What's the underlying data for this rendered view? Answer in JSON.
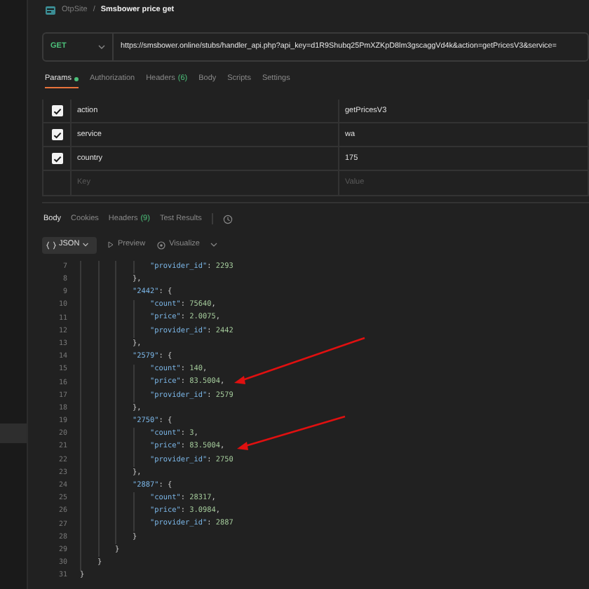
{
  "breadcrumb": {
    "workspace": "OtpSite",
    "separator": "/",
    "request": "Smsbower price get"
  },
  "request": {
    "method": "GET",
    "url": "https://smsbower.online/stubs/handler_api.php?api_key=d1R9Shubq25PmXZKpD8lm3gscaggVd4k&action=getPricesV3&service="
  },
  "request_tabs": [
    {
      "label": "Params",
      "dot": true,
      "selected": true
    },
    {
      "label": "Authorization",
      "dot": false,
      "selected": false
    },
    {
      "label": "Headers",
      "count": "(6)",
      "dot": false,
      "selected": false
    },
    {
      "label": "Body",
      "dot": false,
      "selected": false
    },
    {
      "label": "Scripts",
      "dot": false,
      "selected": false
    },
    {
      "label": "Settings",
      "dot": false,
      "selected": false
    }
  ],
  "params": [
    {
      "key": "action",
      "value": "getPricesV3",
      "checked": true
    },
    {
      "key": "service",
      "value": "wa",
      "checked": true
    },
    {
      "key": "country",
      "value": "175",
      "checked": true
    }
  ],
  "new_param": {
    "key_placeholder": "Key",
    "value_placeholder": "Value"
  },
  "response_tabs": [
    {
      "label": "Body",
      "selected": true
    },
    {
      "label": "Cookies",
      "selected": false
    },
    {
      "label": "Headers",
      "count": "(9)",
      "selected": false
    },
    {
      "label": "Test Results",
      "selected": false
    }
  ],
  "response_toolbar": {
    "format": "JSON",
    "preview": "Preview",
    "visualize": "Visualize"
  },
  "code_lines": [
    {
      "number": "7",
      "text": "        \"provider_id\": 2293"
    },
    {
      "number": "8",
      "text": "      },"
    },
    {
      "number": "9",
      "text": "      \"2442\": {"
    },
    {
      "number": "10",
      "text": "        \"count\": 75640,"
    },
    {
      "number": "11",
      "text": "        \"price\": 2.0075,"
    },
    {
      "number": "12",
      "text": "        \"provider_id\": 2442"
    },
    {
      "number": "13",
      "text": "      },"
    },
    {
      "number": "14",
      "text": "      \"2579\": {"
    },
    {
      "number": "15",
      "text": "        \"count\": 140,"
    },
    {
      "number": "16",
      "text": "        \"price\": 83.5004,"
    },
    {
      "number": "17",
      "text": "        \"provider_id\": 2579"
    },
    {
      "number": "18",
      "text": "      },"
    },
    {
      "number": "19",
      "text": "      \"2750\": {"
    },
    {
      "number": "20",
      "text": "        \"count\": 3,"
    },
    {
      "number": "21",
      "text": "        \"price\": 83.5004,"
    },
    {
      "number": "22",
      "text": "        \"provider_id\": 2750"
    },
    {
      "number": "23",
      "text": "      },"
    },
    {
      "number": "24",
      "text": "      \"2887\": {"
    },
    {
      "number": "25",
      "text": "        \"count\": 28317,"
    },
    {
      "number": "26",
      "text": "        \"price\": 3.0984,"
    },
    {
      "number": "27",
      "text": "        \"provider_id\": 2887"
    },
    {
      "number": "28",
      "text": "      }"
    },
    {
      "number": "29",
      "text": "    }"
    },
    {
      "number": "30",
      "text": "  }"
    },
    {
      "number": "31",
      "text": "}"
    }
  ]
}
